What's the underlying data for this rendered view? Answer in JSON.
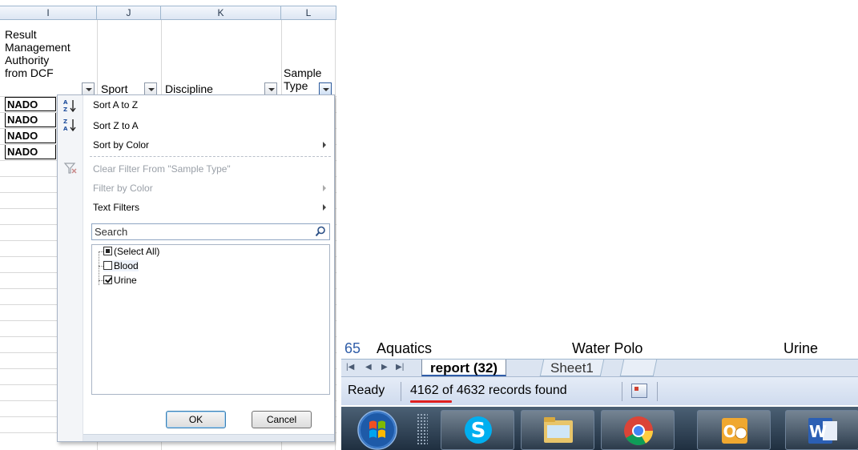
{
  "columns": [
    "I",
    "J",
    "K",
    "L"
  ],
  "headers": {
    "i_line1": "Result",
    "i_line2": "Management",
    "i_line3": "Authority",
    "i_line4": "from DCF",
    "j": "Sport",
    "k": "Discipline",
    "l_line1": "Sample",
    "l_line2": "Type"
  },
  "rows": [
    "NADO",
    "NADO",
    "NADO",
    "NADO"
  ],
  "filter": {
    "sort_az": "Sort A to Z",
    "sort_za": "Sort Z to A",
    "sort_color": "Sort by Color",
    "clear_filter": "Clear Filter From \"Sample Type\"",
    "filter_color": "Filter by Color",
    "text_filters": "Text Filters",
    "search_placeholder": "Search",
    "options": {
      "select_all": "(Select All)",
      "blood": "Blood",
      "urine": "Urine"
    },
    "ok": "OK",
    "cancel": "Cancel"
  },
  "zoom": {
    "row_num": "65",
    "sport": "Aquatics",
    "discipline": "Water Polo",
    "sample": "Urine",
    "tab_active": "report (32)",
    "tab_other": "Sheet1",
    "status_ready": "Ready",
    "status_records": "4162 of 4632 records found"
  }
}
